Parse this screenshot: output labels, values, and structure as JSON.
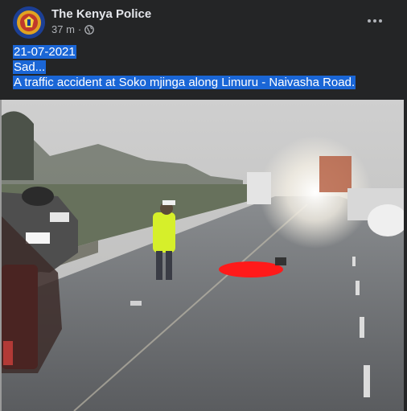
{
  "post": {
    "page_name": "The Kenya Police",
    "time": "37 m",
    "separator": "·",
    "audience_icon": "globe-icon",
    "more_icon": "more-options-icon",
    "text_lines": [
      "21-07-2021",
      "Sad...",
      "A traffic accident at Soko mjinga along Limuru - Naivasha Road."
    ],
    "photo_icon": "accident-scene-photo"
  },
  "colors": {
    "background": "#242526",
    "text": "#e4e6eb",
    "secondary_text": "#b0b3b8",
    "selection": "#1a66d6"
  }
}
